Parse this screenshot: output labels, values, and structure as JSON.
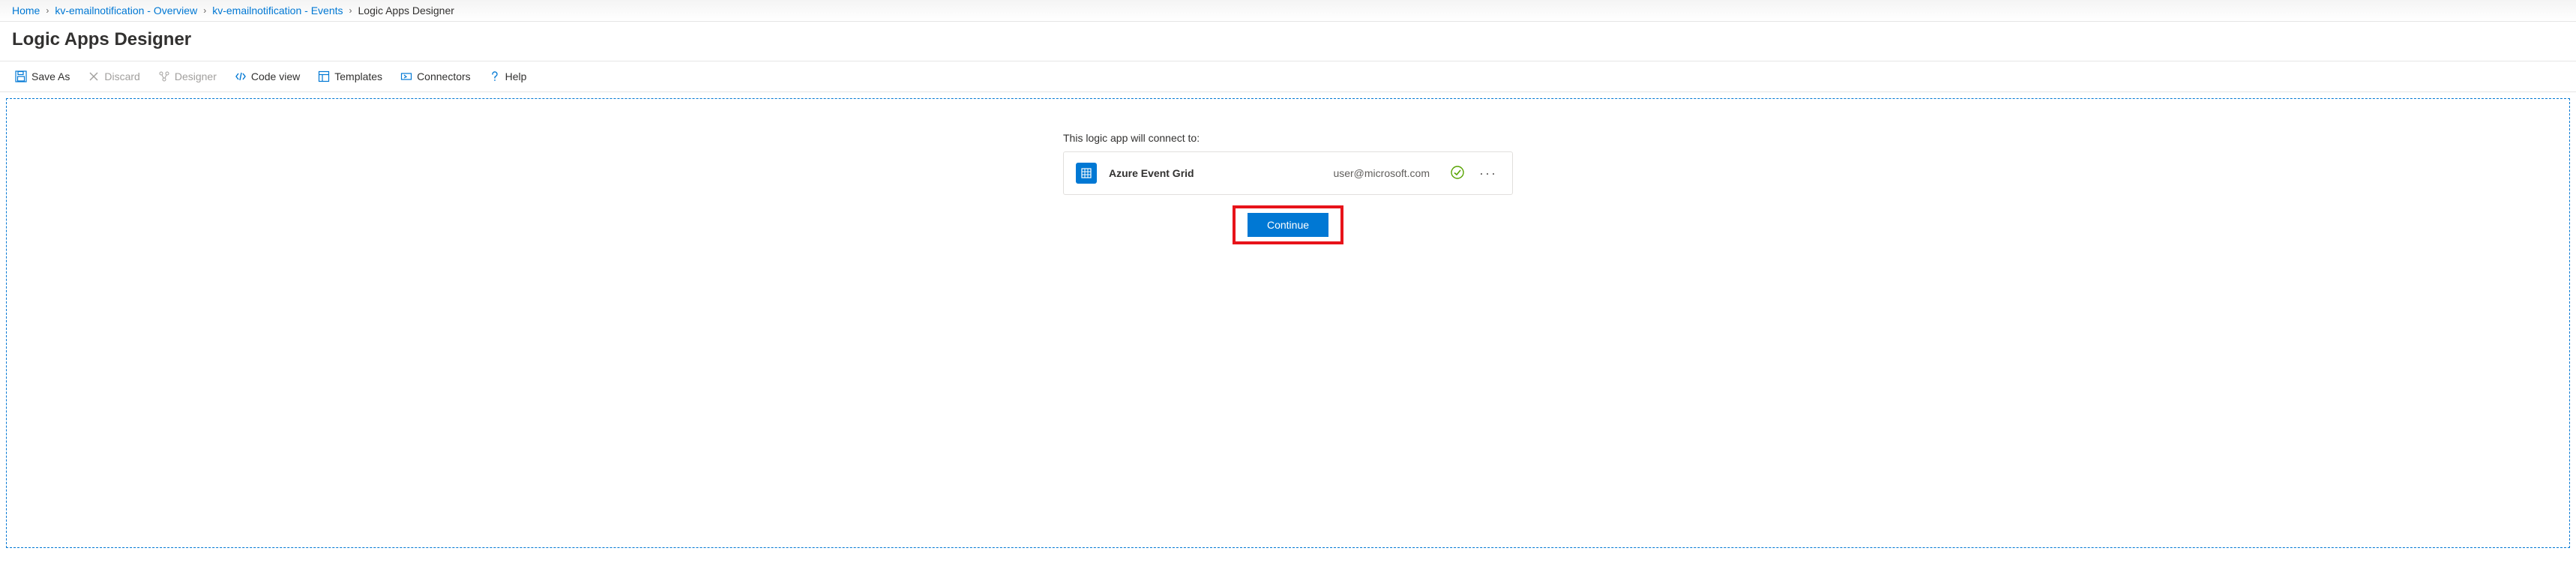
{
  "breadcrumb": {
    "items": [
      {
        "label": "Home"
      },
      {
        "label": "kv-emailnotification - Overview"
      },
      {
        "label": "kv-emailnotification - Events"
      }
    ],
    "current": "Logic Apps Designer"
  },
  "page_title": "Logic Apps Designer",
  "toolbar": {
    "save_as": "Save As",
    "discard": "Discard",
    "designer": "Designer",
    "code_view": "Code view",
    "templates": "Templates",
    "connectors": "Connectors",
    "help": "Help"
  },
  "canvas": {
    "connect_label": "This logic app will connect to:",
    "connection": {
      "name": "Azure Event Grid",
      "user": "user@microsoft.com",
      "status": "ok"
    },
    "continue_label": "Continue"
  },
  "colors": {
    "primary": "#0078d4",
    "highlight_border": "#e7131a",
    "success": "#57a300"
  }
}
